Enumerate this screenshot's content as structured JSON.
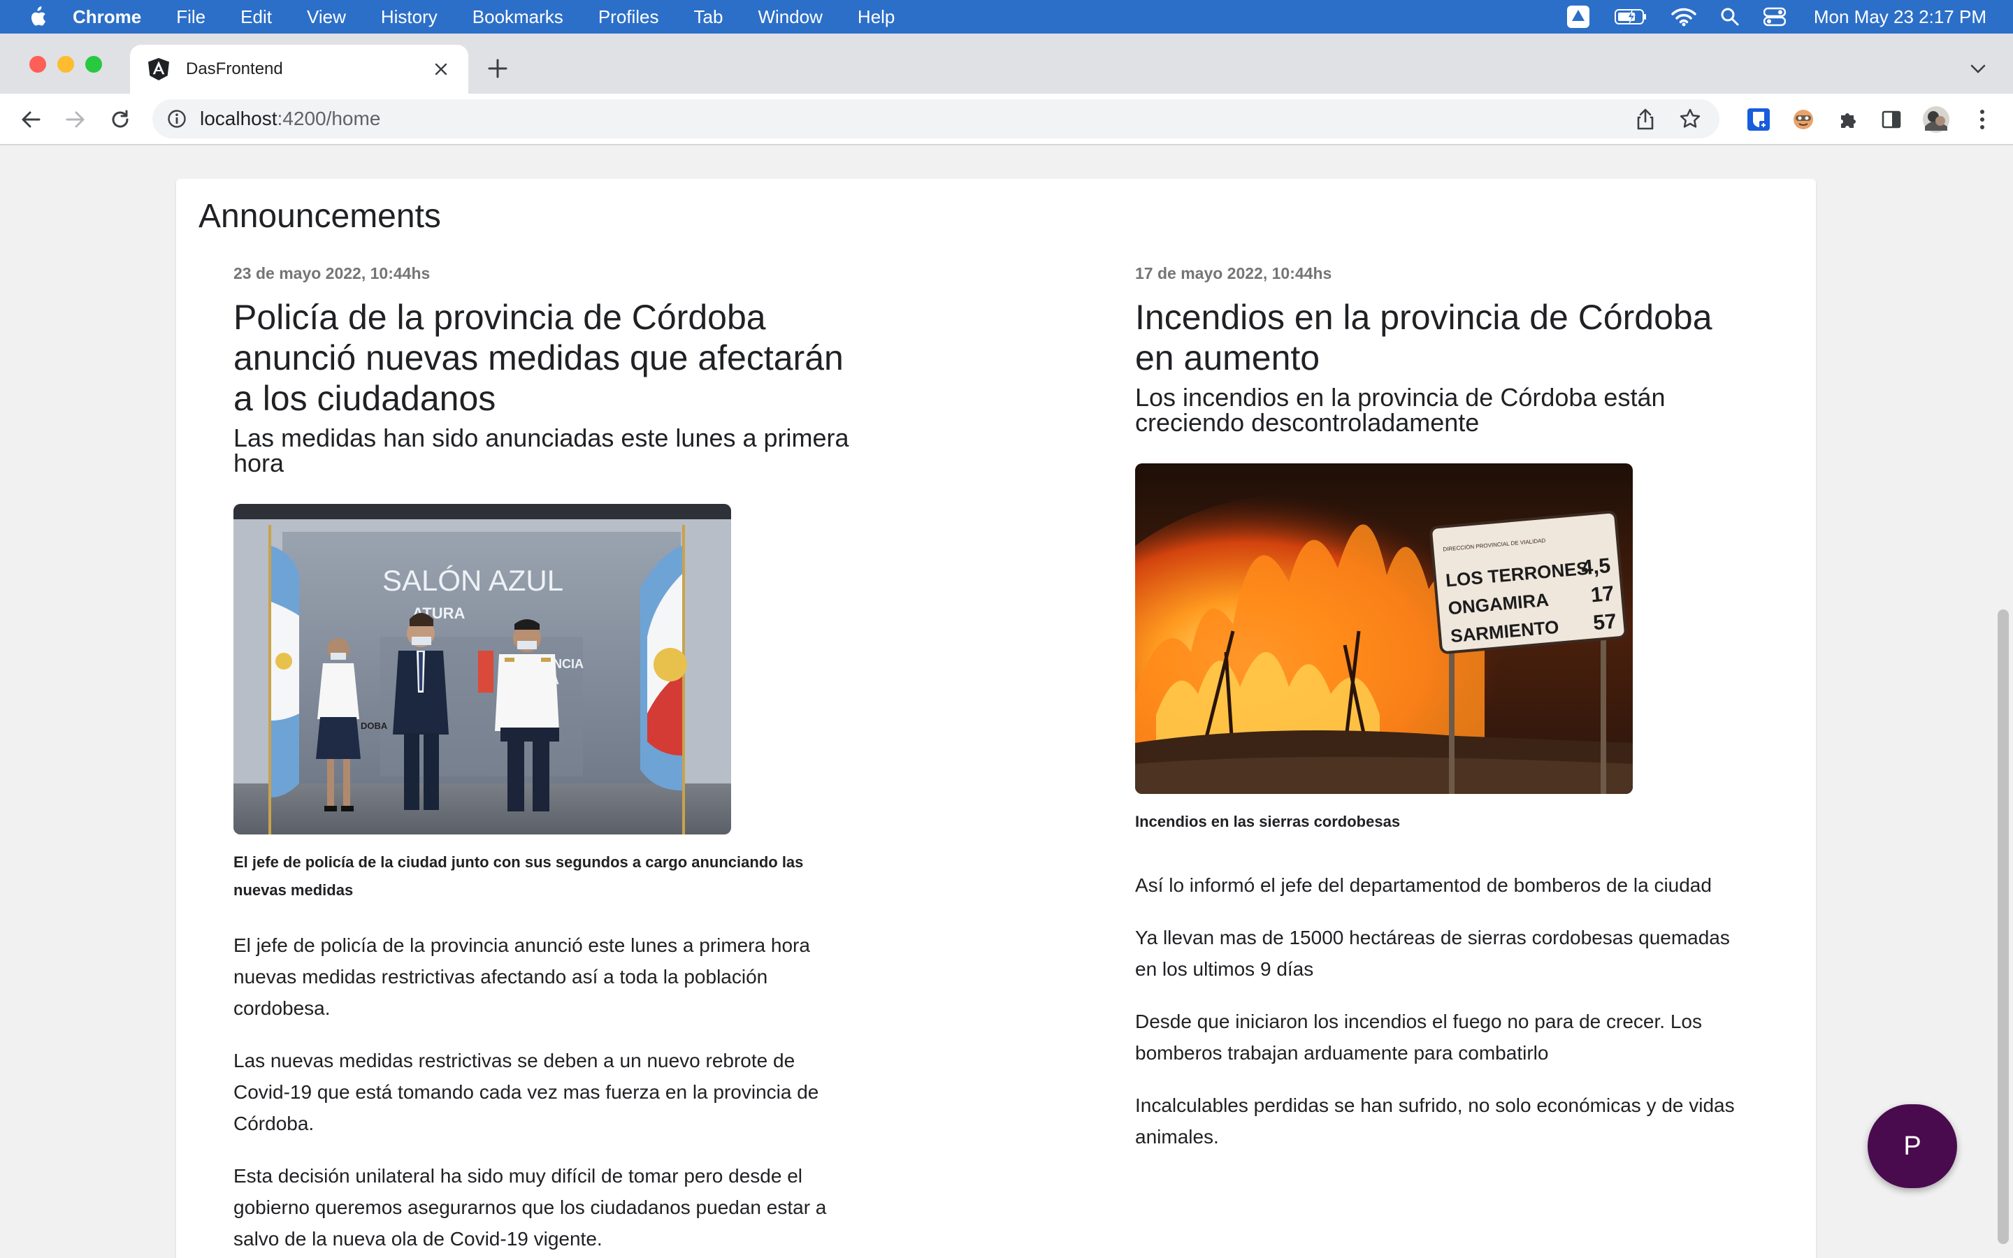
{
  "menubar": {
    "app": "Chrome",
    "items": [
      "File",
      "Edit",
      "View",
      "History",
      "Bookmarks",
      "Profiles",
      "Tab",
      "Window",
      "Help"
    ],
    "clock": "Mon May 23  2:17 PM"
  },
  "browser": {
    "tab_title": "DasFrontend",
    "url_host": "localhost",
    "url_path": ":4200/home"
  },
  "page": {
    "section_title": "Announcements",
    "articles": [
      {
        "date": "23 de mayo 2022, 10:44hs",
        "title": "Policía de la provincia de Córdoba anunció nuevas medidas que afectarán a los ciudadanos",
        "subtitle": "Las medidas han sido anunciadas este lunes a primera hora",
        "image_text": "SALÓN AZUL",
        "caption": "El jefe de policía de la ciudad junto con sus segundos a cargo anunciando las nuevas medidas",
        "paragraphs": [
          "El jefe de policía de la provincia anunció este lunes a primera hora nuevas medidas restrictivas afectando así a toda la población cordobesa.",
          "Las nuevas medidas restrictivas se deben a un nuevo rebrote de Covid-19 que está tomando cada vez mas fuerza en la provincia de Córdoba.",
          "Esta decisión unilateral ha sido muy difícil de tomar pero desde el gobierno queremos asegurarnos que los ciudadanos puedan estar a salvo de la nueva ola de Covid-19 vigente."
        ]
      },
      {
        "date": "17 de mayo 2022, 10:44hs",
        "title": "Incendios en la provincia de Córdoba en aumento",
        "subtitle": "Los incendios en la provincia de Córdoba están creciendo descontroladamente",
        "image_sign": [
          "LOS TERRONES",
          "4,5",
          "ONGAMIRA",
          "17",
          "SARMIENTO",
          "57"
        ],
        "caption": "Incendios en las sierras cordobesas",
        "paragraphs": [
          "Así lo informó el jefe del departamentod de bomberos de la ciudad",
          "Ya llevan mas de 15000 hectáreas de sierras cordobesas quemadas en los ultimos 9 días",
          "Desde que iniciaron los incendios el fuego no para de crecer. Los bomberos trabajan arduamente para combatirlo",
          "Incalculables perdidas se han sufrido, no solo económicas y de vidas animales."
        ]
      }
    ],
    "fab_label": "P"
  }
}
